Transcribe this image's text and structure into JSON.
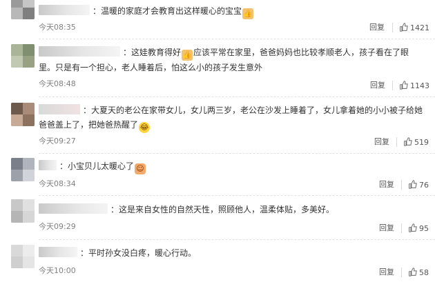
{
  "comments": [
    {
      "text": "：温暖的家庭才会教育出这样暖心的宝宝",
      "emoji_after": "thumbs-up-emoji",
      "time": "今天08:35",
      "reply": "回复",
      "likes": "1421"
    },
    {
      "text_1": "：这娃教育得好",
      "emoji_mid": "thumbs-up-emoji",
      "text_2": "应该平常在家里，爸爸妈妈也比较孝顺老人，孩子看在了眼里。只是有一个担心，老人睡着后，怕这么小的孩子发生意外",
      "time": "今天08:48",
      "reply": "回复",
      "likes": "1143"
    },
    {
      "text": "：大夏天的老公在家带女儿，女儿两三岁，老公在沙发上睡着了，女儿拿着她的小小被子给她爸爸盖上了，把她爸热醒了",
      "emoji_after": "laughing-emoji",
      "time": "今天09:27",
      "reply": "回复",
      "likes": "519"
    },
    {
      "text": "：小宝贝儿太暖心了",
      "emoji_after": "cute-emoji",
      "time": "今天08:34",
      "reply": "回复",
      "likes": "76"
    },
    {
      "text": "：这是来自女性的自然天性，照顾他人，温柔体贴，多美好。",
      "time": "今天09:29",
      "reply": "回复",
      "likes": "95"
    },
    {
      "text": "：平时孙女没白疼，暖心行动。",
      "time": "今天10:00",
      "reply": "回复",
      "likes": "58"
    }
  ],
  "colors": {
    "text": "#333333",
    "time": "#808080",
    "divider": "#e2e2e2"
  },
  "icons": {
    "like": "thumbs-up-outline-icon"
  }
}
